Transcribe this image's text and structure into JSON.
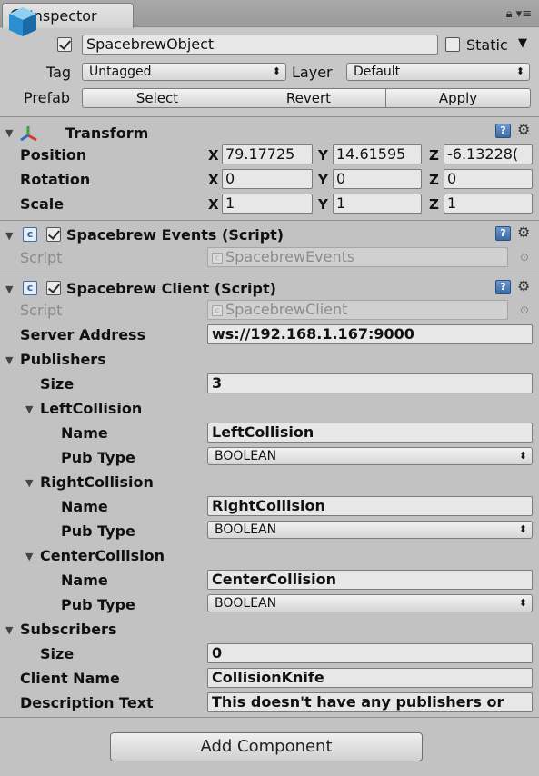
{
  "tab": {
    "title": "Inspector"
  },
  "object": {
    "name": "SpacebrewObject",
    "active": true,
    "static_label": "Static",
    "static": false,
    "tag_label": "Tag",
    "tag_value": "Untagged",
    "layer_label": "Layer",
    "layer_value": "Default",
    "prefab_label": "Prefab",
    "prefab_buttons": [
      "Select",
      "Revert",
      "Apply"
    ]
  },
  "transform": {
    "title": "Transform",
    "position_label": "Position",
    "rotation_label": "Rotation",
    "scale_label": "Scale",
    "axis_x": "X",
    "axis_y": "Y",
    "axis_z": "Z",
    "position": {
      "x": "79.17725",
      "y": "14.61595",
      "z": "-6.13228("
    },
    "rotation": {
      "x": "0",
      "y": "0",
      "z": "0"
    },
    "scale": {
      "x": "1",
      "y": "1",
      "z": "1"
    }
  },
  "events_component": {
    "title": "Spacebrew Events (Script)",
    "enabled": true,
    "script_label": "Script",
    "script_value": "SpacebrewEvents"
  },
  "client_component": {
    "title": "Spacebrew Client (Script)",
    "enabled": true,
    "script_label": "Script",
    "script_value": "SpacebrewClient",
    "server_label": "Server Address",
    "server_value": "ws://192.168.1.167:9000",
    "publishers_label": "Publishers",
    "size_label": "Size",
    "publishers_size": "3",
    "name_label": "Name",
    "pubtype_label": "Pub Type",
    "publishers": [
      {
        "header": "LeftCollision",
        "name": "LeftCollision",
        "type": "BOOLEAN"
      },
      {
        "header": "RightCollision",
        "name": "RightCollision",
        "type": "BOOLEAN"
      },
      {
        "header": "CenterCollision",
        "name": "CenterCollision",
        "type": "BOOLEAN"
      }
    ],
    "subscribers_label": "Subscribers",
    "subscribers_size": "0",
    "client_name_label": "Client Name",
    "client_name_value": "CollisionKnife",
    "description_label": "Description Text",
    "description_value": "This doesn't have any publishers or"
  },
  "add_component_label": "Add Component"
}
